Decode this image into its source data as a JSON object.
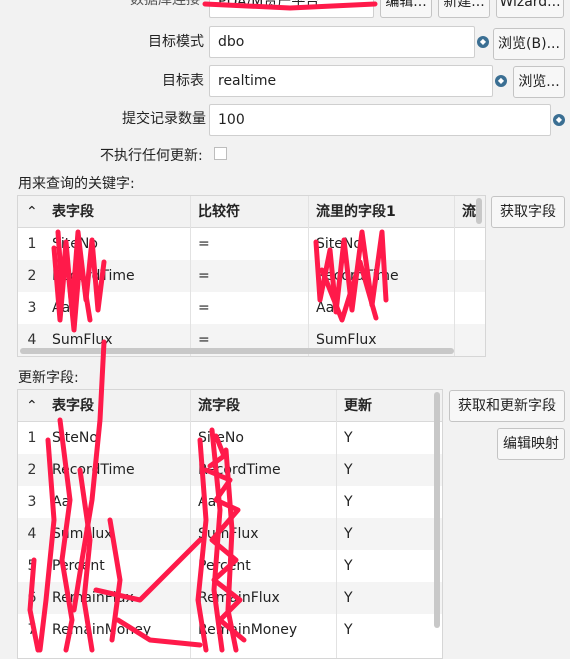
{
  "top": {
    "connection_label": "数据库连接",
    "connection_value": "PDA/M资产平台",
    "edit_button": "编辑...",
    "new_button": "新建...",
    "wizard_button": "Wizard..."
  },
  "form": {
    "schema_label": "目标模式",
    "schema_value": "dbo",
    "browse_schema_button": "浏览(B)...",
    "table_label": "目标表",
    "table_value": "realtime",
    "browse_table_button": "浏览...",
    "commit_label": "提交记录数量",
    "commit_value": "100",
    "no_update_label": "不执行任何更新:"
  },
  "lookup": {
    "section_label": "用来查询的关键字:",
    "get_fields_button": "获取字段",
    "columns": [
      "表字段",
      "比较符",
      "流里的字段1",
      "流"
    ],
    "rows": [
      {
        "num": "1",
        "field": "SiteNo",
        "cmp": "=",
        "stream": "SiteNo"
      },
      {
        "num": "2",
        "field": "RecordTime",
        "cmp": "=",
        "stream": "RecordTime"
      },
      {
        "num": "3",
        "field": "Aa",
        "cmp": "=",
        "stream": "Aa"
      },
      {
        "num": "4",
        "field": "SumFlux",
        "cmp": "=",
        "stream": "SumFlux"
      }
    ]
  },
  "update": {
    "section_label": "更新字段:",
    "get_update_button": "获取和更新字段",
    "edit_mapping_button": "编辑映射",
    "columns": [
      "表字段",
      "流字段",
      "更新"
    ],
    "rows": [
      {
        "num": "1",
        "field": "SiteNo",
        "stream": "SiteNo",
        "upd": "Y"
      },
      {
        "num": "2",
        "field": "RecordTime",
        "stream": "RecordTime",
        "upd": "Y"
      },
      {
        "num": "3",
        "field": "Aa",
        "stream": "Aa",
        "upd": "Y"
      },
      {
        "num": "4",
        "field": "SumFlux",
        "stream": "SumFlux",
        "upd": "Y"
      },
      {
        "num": "5",
        "field": "Percent",
        "stream": "Percent",
        "upd": "Y"
      },
      {
        "num": "6",
        "field": "RemainFlux",
        "stream": "RemainFlux",
        "upd": "Y"
      },
      {
        "num": "7",
        "field": "RemainMoney",
        "stream": "RemainMoney",
        "upd": "Y"
      }
    ]
  },
  "colors": {
    "scribble": "#ff1a4a",
    "var_icon": "#3b6f93"
  }
}
